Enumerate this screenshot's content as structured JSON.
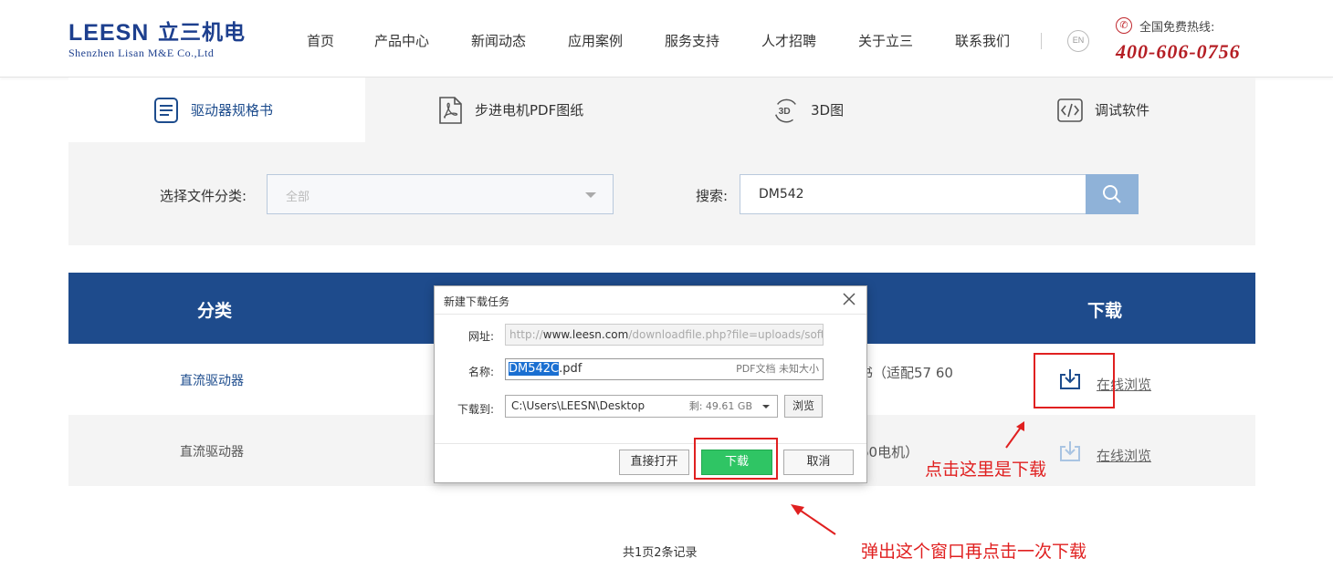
{
  "header": {
    "logo_mark": "LEESN",
    "logo_cn": "立三机电",
    "logo_en": "Shenzhen Lisan M&E Co.,Ltd",
    "nav": [
      "首页",
      "产品中心",
      "新闻动态",
      "应用案例",
      "服务支持",
      "人才招聘",
      "关于立三",
      "联系我们"
    ],
    "lang_button": "EN",
    "hotline_label": "全国免费热线:",
    "hotline_number": "400-606-0756",
    "hotline_color": "#b51e24"
  },
  "tabs": [
    {
      "label": "驱动器规格书",
      "icon": "document-list-icon",
      "active": true
    },
    {
      "label": "步进电机PDF图纸",
      "icon": "pdf-icon",
      "active": false
    },
    {
      "label": "3D图",
      "icon": "3d-rotate-icon",
      "active": false
    },
    {
      "label": "调试软件",
      "icon": "code-icon",
      "active": false
    }
  ],
  "filter": {
    "category_label": "选择文件分类:",
    "category_value": "全部",
    "search_label": "搜索:",
    "search_value": "DM542"
  },
  "table": {
    "headers": {
      "category": "分类",
      "download": "下载"
    },
    "rows": [
      {
        "category": "直流驱动器",
        "desc_partial": "书（适配57 60",
        "view_link": "在线浏览"
      },
      {
        "category": "直流驱动器",
        "desc_partial": "60电机）",
        "view_link": "在线浏览"
      }
    ]
  },
  "pager": {
    "text": "共1页2条记录"
  },
  "dialog": {
    "title": "新建下载任务",
    "url_label": "网址:",
    "url_prefix": "http://",
    "url_host": "www.leesn.com",
    "url_rest": "/downloadfile.php?file=uploads/soft/",
    "name_label": "名称:",
    "name_selected": "DM542C",
    "name_ext": ".pdf",
    "name_type": "PDF文档 未知大小",
    "path_label": "下载到:",
    "path_value": "C:\\Users\\LEESN\\Desktop",
    "path_space": "剩: 49.61 GB",
    "browse_label": "浏览",
    "open_label": "直接打开",
    "download_label": "下载",
    "cancel_label": "取消",
    "primary_color": "#2fc564"
  },
  "annotations": {
    "click_here": "点击这里是下载",
    "popup_note": "弹出这个窗口再点击一次下载",
    "color": "#e02020"
  }
}
